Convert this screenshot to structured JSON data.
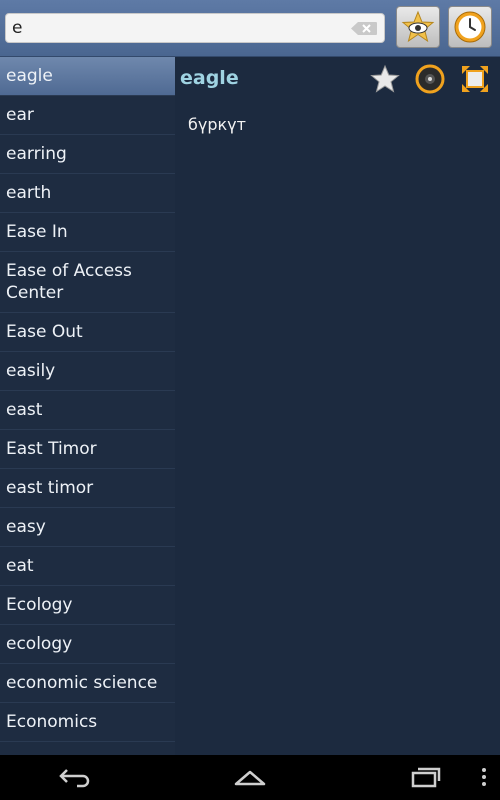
{
  "search": {
    "value": "e",
    "placeholder": ""
  },
  "toolbar": {
    "favorites_icon": "star-eye-icon",
    "history_icon": "clock-icon"
  },
  "words": [
    "eagle",
    "ear",
    "earring",
    "earth",
    "Ease In",
    "Ease of Access Center",
    "Ease Out",
    "easily",
    "east",
    "East Timor",
    "east timor",
    "easy",
    "eat",
    "Ecology",
    "ecology",
    "economic science",
    "Economics"
  ],
  "selected_index": 0,
  "entry": {
    "headword": "eagle",
    "translation": "бүркүт"
  },
  "entry_actions": [
    "star-icon",
    "speaker-icon",
    "fullscreen-icon"
  ],
  "colors": {
    "accent": "#9fd3e2",
    "selected_bg": "#5f7aa0",
    "background": "#1c2a3f"
  }
}
